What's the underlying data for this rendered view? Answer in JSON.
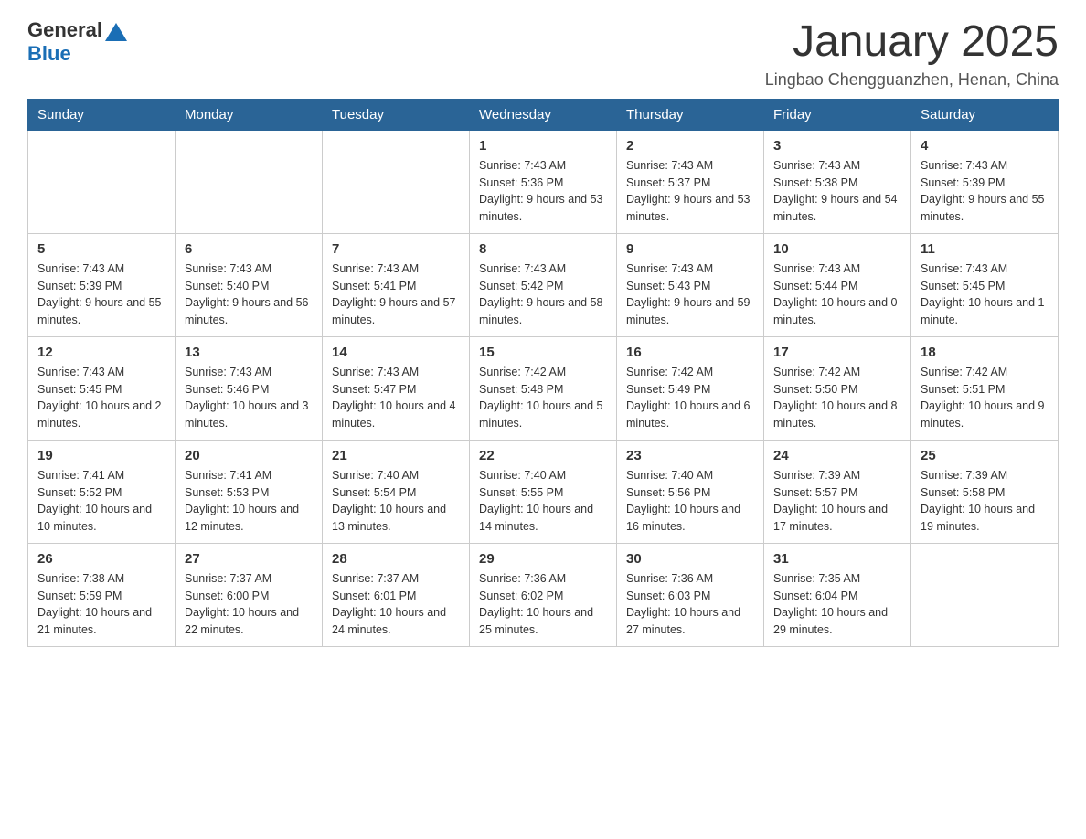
{
  "header": {
    "logo_general": "General",
    "logo_blue": "Blue",
    "month_title": "January 2025",
    "location": "Lingbao Chengguanzhen, Henan, China"
  },
  "days_of_week": [
    "Sunday",
    "Monday",
    "Tuesday",
    "Wednesday",
    "Thursday",
    "Friday",
    "Saturday"
  ],
  "weeks": [
    {
      "days": [
        {
          "number": "",
          "info": ""
        },
        {
          "number": "",
          "info": ""
        },
        {
          "number": "",
          "info": ""
        },
        {
          "number": "1",
          "info": "Sunrise: 7:43 AM\nSunset: 5:36 PM\nDaylight: 9 hours\nand 53 minutes."
        },
        {
          "number": "2",
          "info": "Sunrise: 7:43 AM\nSunset: 5:37 PM\nDaylight: 9 hours\nand 53 minutes."
        },
        {
          "number": "3",
          "info": "Sunrise: 7:43 AM\nSunset: 5:38 PM\nDaylight: 9 hours\nand 54 minutes."
        },
        {
          "number": "4",
          "info": "Sunrise: 7:43 AM\nSunset: 5:39 PM\nDaylight: 9 hours\nand 55 minutes."
        }
      ]
    },
    {
      "days": [
        {
          "number": "5",
          "info": "Sunrise: 7:43 AM\nSunset: 5:39 PM\nDaylight: 9 hours\nand 55 minutes."
        },
        {
          "number": "6",
          "info": "Sunrise: 7:43 AM\nSunset: 5:40 PM\nDaylight: 9 hours\nand 56 minutes."
        },
        {
          "number": "7",
          "info": "Sunrise: 7:43 AM\nSunset: 5:41 PM\nDaylight: 9 hours\nand 57 minutes."
        },
        {
          "number": "8",
          "info": "Sunrise: 7:43 AM\nSunset: 5:42 PM\nDaylight: 9 hours\nand 58 minutes."
        },
        {
          "number": "9",
          "info": "Sunrise: 7:43 AM\nSunset: 5:43 PM\nDaylight: 9 hours\nand 59 minutes."
        },
        {
          "number": "10",
          "info": "Sunrise: 7:43 AM\nSunset: 5:44 PM\nDaylight: 10 hours\nand 0 minutes."
        },
        {
          "number": "11",
          "info": "Sunrise: 7:43 AM\nSunset: 5:45 PM\nDaylight: 10 hours\nand 1 minute."
        }
      ]
    },
    {
      "days": [
        {
          "number": "12",
          "info": "Sunrise: 7:43 AM\nSunset: 5:45 PM\nDaylight: 10 hours\nand 2 minutes."
        },
        {
          "number": "13",
          "info": "Sunrise: 7:43 AM\nSunset: 5:46 PM\nDaylight: 10 hours\nand 3 minutes."
        },
        {
          "number": "14",
          "info": "Sunrise: 7:43 AM\nSunset: 5:47 PM\nDaylight: 10 hours\nand 4 minutes."
        },
        {
          "number": "15",
          "info": "Sunrise: 7:42 AM\nSunset: 5:48 PM\nDaylight: 10 hours\nand 5 minutes."
        },
        {
          "number": "16",
          "info": "Sunrise: 7:42 AM\nSunset: 5:49 PM\nDaylight: 10 hours\nand 6 minutes."
        },
        {
          "number": "17",
          "info": "Sunrise: 7:42 AM\nSunset: 5:50 PM\nDaylight: 10 hours\nand 8 minutes."
        },
        {
          "number": "18",
          "info": "Sunrise: 7:42 AM\nSunset: 5:51 PM\nDaylight: 10 hours\nand 9 minutes."
        }
      ]
    },
    {
      "days": [
        {
          "number": "19",
          "info": "Sunrise: 7:41 AM\nSunset: 5:52 PM\nDaylight: 10 hours\nand 10 minutes."
        },
        {
          "number": "20",
          "info": "Sunrise: 7:41 AM\nSunset: 5:53 PM\nDaylight: 10 hours\nand 12 minutes."
        },
        {
          "number": "21",
          "info": "Sunrise: 7:40 AM\nSunset: 5:54 PM\nDaylight: 10 hours\nand 13 minutes."
        },
        {
          "number": "22",
          "info": "Sunrise: 7:40 AM\nSunset: 5:55 PM\nDaylight: 10 hours\nand 14 minutes."
        },
        {
          "number": "23",
          "info": "Sunrise: 7:40 AM\nSunset: 5:56 PM\nDaylight: 10 hours\nand 16 minutes."
        },
        {
          "number": "24",
          "info": "Sunrise: 7:39 AM\nSunset: 5:57 PM\nDaylight: 10 hours\nand 17 minutes."
        },
        {
          "number": "25",
          "info": "Sunrise: 7:39 AM\nSunset: 5:58 PM\nDaylight: 10 hours\nand 19 minutes."
        }
      ]
    },
    {
      "days": [
        {
          "number": "26",
          "info": "Sunrise: 7:38 AM\nSunset: 5:59 PM\nDaylight: 10 hours\nand 21 minutes."
        },
        {
          "number": "27",
          "info": "Sunrise: 7:37 AM\nSunset: 6:00 PM\nDaylight: 10 hours\nand 22 minutes."
        },
        {
          "number": "28",
          "info": "Sunrise: 7:37 AM\nSunset: 6:01 PM\nDaylight: 10 hours\nand 24 minutes."
        },
        {
          "number": "29",
          "info": "Sunrise: 7:36 AM\nSunset: 6:02 PM\nDaylight: 10 hours\nand 25 minutes."
        },
        {
          "number": "30",
          "info": "Sunrise: 7:36 AM\nSunset: 6:03 PM\nDaylight: 10 hours\nand 27 minutes."
        },
        {
          "number": "31",
          "info": "Sunrise: 7:35 AM\nSunset: 6:04 PM\nDaylight: 10 hours\nand 29 minutes."
        },
        {
          "number": "",
          "info": ""
        }
      ]
    }
  ]
}
